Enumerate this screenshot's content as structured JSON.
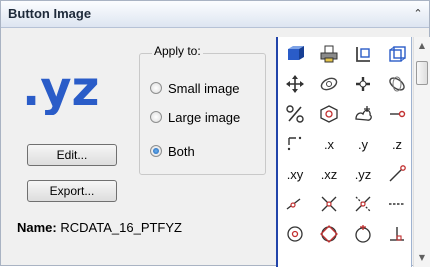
{
  "panel": {
    "title": "Button Image"
  },
  "preview": {
    "text": ".yz"
  },
  "apply_to": {
    "legend": "Apply to:",
    "options": [
      {
        "label": "Small image",
        "checked": false
      },
      {
        "label": "Large image",
        "checked": false
      },
      {
        "label": "Both",
        "checked": true
      }
    ]
  },
  "buttons": {
    "edit": "Edit...",
    "export": "Export..."
  },
  "name": {
    "key": "Name:",
    "value": "RCDATA_16_PTFYZ"
  },
  "icon_grid": {
    "rows": [
      [
        {
          "icon": "blue-3d-object-icon"
        },
        {
          "icon": "printer-icon"
        },
        {
          "icon": "corner-bracket-icon"
        },
        {
          "icon": "blue-grid-cube-icon"
        }
      ],
      [
        {
          "icon": "four-way-move-icon"
        },
        {
          "icon": "orbit-icon"
        },
        {
          "icon": "pan-cross-icon"
        },
        {
          "icon": "free-orbit-icon"
        }
      ],
      [
        {
          "icon": "percent-icon"
        },
        {
          "icon": "cube-target-icon"
        },
        {
          "icon": "point-cloud-icon"
        },
        {
          "icon": "line-endpoint-icon"
        }
      ],
      [
        {
          "icon": "corner-dots-icon"
        },
        {
          "text": ".x"
        },
        {
          "text": ".y"
        },
        {
          "text": ".z"
        }
      ],
      [
        {
          "text": ".xy"
        },
        {
          "text": ".xz"
        },
        {
          "text": ".yz"
        },
        {
          "icon": "diagonal-line-icon"
        }
      ],
      [
        {
          "icon": "angled-line-icon"
        },
        {
          "icon": "x-cross-icon"
        },
        {
          "icon": "x-cross-dotted-icon"
        },
        {
          "icon": "dashed-line-icon"
        }
      ],
      [
        {
          "icon": "circle-center-icon"
        },
        {
          "icon": "diamond-circle-icon"
        },
        {
          "icon": "circle-arc-icon"
        },
        {
          "icon": "perpendicular-icon"
        }
      ]
    ]
  },
  "colors": {
    "accent_blue": "#2a5cc8",
    "grid_border": "#2244aa",
    "title_text": "#1e2a3a"
  }
}
